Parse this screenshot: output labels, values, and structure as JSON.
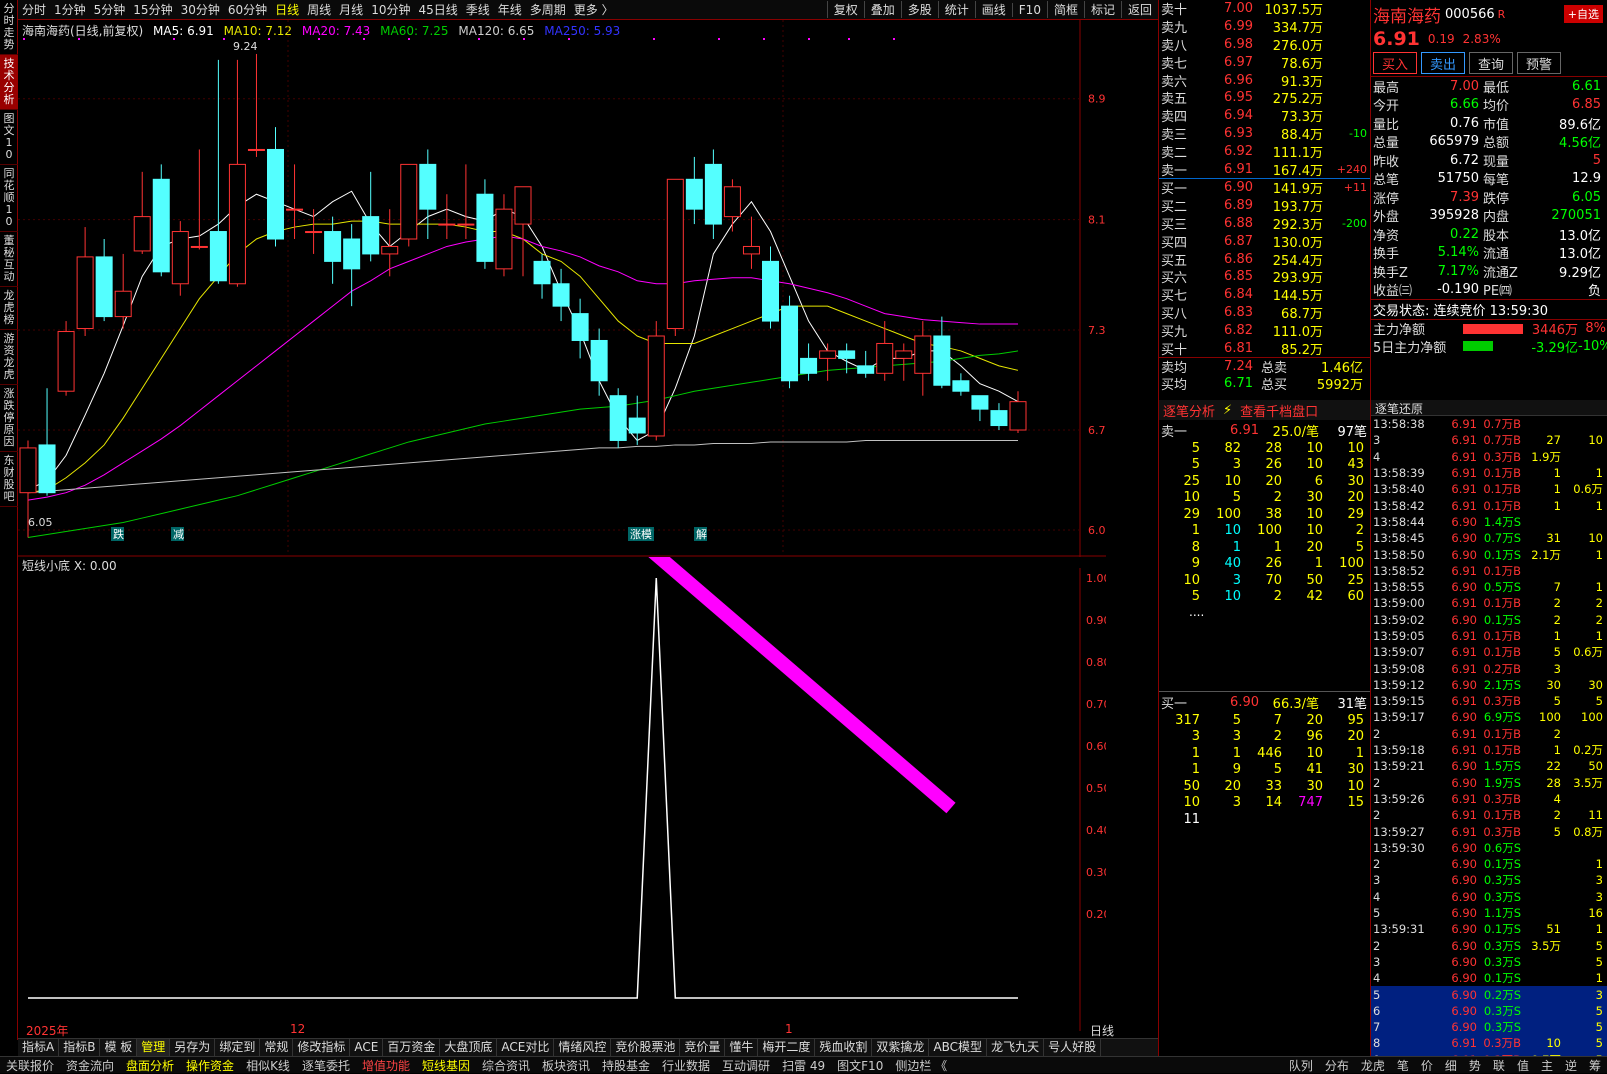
{
  "stock": {
    "name": "海南海药",
    "code": "000566",
    "flag": "R",
    "add_btn": "+自选",
    "price": "6.91",
    "change": "0.19",
    "pct": "2.83%"
  },
  "leftbar": [
    "分时走势",
    "技术分析",
    "图文10",
    "同花顺10",
    "董秘互动",
    "龙虎榜",
    "游资龙虎",
    "涨跌停原因",
    "东财股吧"
  ],
  "periods": [
    "分时",
    "1分钟",
    "5分钟",
    "15分钟",
    "30分钟",
    "60分钟",
    "日线",
    "周线",
    "月线",
    "10分钟",
    "45日线",
    "季线",
    "年线",
    "多周期",
    "更多 〉"
  ],
  "active_period": "日线",
  "right_buttons": [
    "复权",
    "叠加",
    "多股",
    "统计",
    "画线",
    "F10",
    "简框",
    "标记",
    "返回"
  ],
  "chart_info": {
    "title": "海南海药(日线,前复权)",
    "ma5": "MA5: 6.91",
    "ma10": "MA10: 7.12",
    "ma20": "MA20: 7.43",
    "ma60": "MA60: 7.25",
    "ma120": "MA120: 6.65",
    "ma250": "MA250: 5.93"
  },
  "main_axis": [
    "8.94",
    "8.13",
    "7.39",
    "6.72",
    "6.05"
  ],
  "price_marks": {
    "high": "9.24",
    "low": "6.05"
  },
  "sub_title": "短线小底 X: 0.00",
  "sub_axis": [
    "1.00",
    "0.90",
    "0.80",
    "0.70",
    "0.60",
    "0.50",
    "0.40",
    "0.30",
    "0.20"
  ],
  "signals": [
    "跌",
    "减",
    "涨模",
    "解"
  ],
  "date_labels": {
    "d1": "2025年",
    "d2": "12",
    "d3": "1",
    "period": "日线"
  },
  "indicator_tabs": [
    "指标A",
    "指标B",
    "模 板",
    "管理",
    "另存为",
    "绑定到",
    "常规",
    "修改指标",
    "ACE",
    "百万资金",
    "大盘顶底",
    "ACE对比",
    "情绪风控",
    "竞价股票池",
    "竞价量",
    "懂牛",
    "梅开二度",
    "残血收割",
    "双紫擒龙",
    "ABC模型",
    "龙飞九天",
    "号人好股"
  ],
  "bottom_items": [
    "关联报价",
    "资金流向",
    "盘面分析",
    "操作资金",
    "相似K线",
    "逐笔委托",
    "增值功能",
    "短线基因",
    "综合资讯",
    "板块资讯",
    "持股基金",
    "行业数据",
    "互动调研",
    "扫雷 49",
    "图文F10",
    "侧边栏 《"
  ],
  "bottom_tabs": [
    "队列",
    "分布",
    "龙虎",
    "笔",
    "价",
    "细",
    "势",
    "联",
    "值",
    "主",
    "逆",
    "筹"
  ],
  "sell_book": [
    [
      "卖十",
      "7.00",
      "1037.5万",
      ""
    ],
    [
      "卖九",
      "6.99",
      "334.7万",
      ""
    ],
    [
      "卖八",
      "6.98",
      "276.0万",
      ""
    ],
    [
      "卖七",
      "6.97",
      "78.6万",
      ""
    ],
    [
      "卖六",
      "6.96",
      "91.3万",
      ""
    ],
    [
      "卖五",
      "6.95",
      "275.2万",
      ""
    ],
    [
      "卖四",
      "6.94",
      "73.3万",
      ""
    ],
    [
      "卖三",
      "6.93",
      "88.4万",
      "-10"
    ],
    [
      "卖二",
      "6.92",
      "111.1万",
      ""
    ],
    [
      "卖一",
      "6.91",
      "167.4万",
      "+240"
    ]
  ],
  "buy_book": [
    [
      "买一",
      "6.90",
      "141.9万",
      "+11"
    ],
    [
      "买二",
      "6.89",
      "193.7万",
      ""
    ],
    [
      "买三",
      "6.88",
      "292.3万",
      "-200"
    ],
    [
      "买四",
      "6.87",
      "130.0万",
      ""
    ],
    [
      "买五",
      "6.86",
      "254.4万",
      ""
    ],
    [
      "买六",
      "6.85",
      "293.9万",
      ""
    ],
    [
      "买七",
      "6.84",
      "144.5万",
      ""
    ],
    [
      "买八",
      "6.83",
      "68.7万",
      ""
    ],
    [
      "买九",
      "6.82",
      "111.0万",
      ""
    ],
    [
      "买十",
      "6.81",
      "85.2万",
      ""
    ]
  ],
  "avg": {
    "sell_label": "卖均",
    "sell": "7.24",
    "sell_total_label": "总卖",
    "sell_total": "1.46亿",
    "buy_label": "买均",
    "buy": "6.71",
    "buy_total_label": "总买",
    "buy_total": "5992万"
  },
  "zhubi": {
    "title": "逐笔分析",
    "link": "查看千档盘口",
    "sell1": "卖一",
    "sell1_price": "6.91",
    "sell1_avg": "25.0/笔",
    "sell1_count": "97笔",
    "buy1": "买一",
    "buy1_price": "6.90",
    "buy1_avg": "66.3/笔",
    "buy1_count": "31笔",
    "sell_rows": [
      [
        "5",
        "82",
        "28",
        "10",
        "10"
      ],
      [
        "5",
        "3",
        "26",
        "10",
        "43"
      ],
      [
        "25",
        "10",
        "20",
        "6",
        "30"
      ],
      [
        "10",
        "5",
        "2",
        "30",
        "20"
      ],
      [
        "29",
        "100",
        "38",
        "10",
        "29"
      ],
      [
        "1",
        "10",
        "100",
        "10",
        "2"
      ],
      [
        "8",
        "1",
        "1",
        "20",
        "5"
      ],
      [
        "9",
        "40",
        "26",
        "1",
        "100"
      ],
      [
        "10",
        "3",
        "70",
        "50",
        "25"
      ],
      [
        "5",
        "10",
        "2",
        "42",
        "60"
      ]
    ],
    "buy_rows": [
      [
        "317",
        "5",
        "7",
        "20",
        "95"
      ],
      [
        "3",
        "3",
        "2",
        "96",
        "20"
      ],
      [
        "1",
        "1",
        "446",
        "10",
        "1"
      ],
      [
        "1",
        "9",
        "5",
        "41",
        "30"
      ],
      [
        "50",
        "20",
        "33",
        "30",
        "10"
      ],
      [
        "10",
        "3",
        "14",
        "747",
        "15"
      ],
      [
        "11",
        "",
        "",
        "",
        ""
      ]
    ],
    "more": "...."
  },
  "buttons": {
    "buy": "买入",
    "sell": "卖出",
    "query": "查询",
    "alert": "预警"
  },
  "quote": [
    [
      "最高",
      "7.00",
      "最低",
      "6.61"
    ],
    [
      "今开",
      "6.66",
      "均价",
      "6.85"
    ],
    [
      "量比",
      "0.76",
      "市值",
      "89.6亿"
    ],
    [
      "总量",
      "665979",
      "总额",
      "4.56亿"
    ],
    [
      "昨收",
      "6.72",
      "现量",
      "5"
    ],
    [
      "总笔",
      "51750",
      "每笔",
      "12.9"
    ],
    [
      "涨停",
      "7.39",
      "跌停",
      "6.05"
    ],
    [
      "外盘",
      "395928",
      "内盘",
      "270051"
    ],
    [
      "净资",
      "0.22",
      "股本",
      "13.0亿"
    ],
    [
      "换手",
      "5.14%",
      "流通",
      "13.0亿"
    ],
    [
      "换手Z",
      "7.17%",
      "流通Z",
      "9.29亿"
    ],
    [
      "收益㈢",
      "-0.190",
      "PE㈣",
      "负"
    ]
  ],
  "trade_status": "交易状态: 连续竞价 13:59:30",
  "main_flow": {
    "l1": "主力净额",
    "v1": "3446万",
    "p1": "8%",
    "l2": "5日主力净额",
    "v2": "-3.29亿",
    "p2": "-10%"
  },
  "tick_title": "逐笔还原",
  "ticks": [
    [
      "13:58:38",
      "6.91",
      "0.7万B",
      "",
      ""
    ],
    [
      "3",
      "6.91",
      "0.7万B",
      "27",
      "10"
    ],
    [
      "4",
      "6.91",
      "0.3万B",
      "1.9万",
      ""
    ],
    [
      "13:58:39",
      "6.91",
      "0.1万B",
      "1",
      "1"
    ],
    [
      "13:58:40",
      "6.91",
      "0.1万B",
      "1",
      "0.6万"
    ],
    [
      "13:58:42",
      "6.91",
      "0.1万B",
      "1",
      "1"
    ],
    [
      "13:58:44",
      "6.90",
      "1.4万S",
      "",
      ""
    ],
    [
      "13:58:45",
      "6.90",
      "0.7万S",
      "31",
      "10"
    ],
    [
      "13:58:50",
      "6.90",
      "0.1万S",
      "2.1万",
      "1"
    ],
    [
      "13:58:52",
      "6.91",
      "0.1万B",
      "",
      ""
    ],
    [
      "13:58:55",
      "6.90",
      "0.5万S",
      "7",
      "1"
    ],
    [
      "13:59:00",
      "6.91",
      "0.1万B",
      "2",
      "2"
    ],
    [
      "13:59:02",
      "6.90",
      "0.1万S",
      "2",
      "2"
    ],
    [
      "13:59:05",
      "6.91",
      "0.1万B",
      "1",
      "1"
    ],
    [
      "13:59:07",
      "6.91",
      "0.1万B",
      "5",
      "0.6万"
    ],
    [
      "13:59:08",
      "6.91",
      "0.2万B",
      "3",
      ""
    ],
    [
      "13:59:12",
      "6.90",
      "2.1万S",
      "30",
      "30"
    ],
    [
      "13:59:15",
      "6.91",
      "0.3万B",
      "5",
      "5"
    ],
    [
      "13:59:17",
      "6.90",
      "6.9万S",
      "100",
      "100"
    ],
    [
      "2",
      "6.91",
      "0.1万B",
      "2",
      ""
    ],
    [
      "13:59:18",
      "6.91",
      "0.1万B",
      "1",
      "0.2万"
    ],
    [
      "13:59:21",
      "6.90",
      "1.5万S",
      "22",
      "50"
    ],
    [
      "2",
      "6.90",
      "1.9万S",
      "28",
      "3.5万"
    ],
    [
      "13:59:26",
      "6.91",
      "0.3万B",
      "4",
      ""
    ],
    [
      "2",
      "6.91",
      "0.1万B",
      "2",
      "11"
    ],
    [
      "13:59:27",
      "6.91",
      "0.3万B",
      "5",
      "0.8万"
    ],
    [
      "13:59:30",
      "6.90",
      "0.6万S",
      "",
      ""
    ],
    [
      "2",
      "6.90",
      "0.1万S",
      "",
      "1"
    ],
    [
      "3",
      "6.90",
      "0.3万S",
      "",
      "3"
    ],
    [
      "4",
      "6.90",
      "0.3万S",
      "",
      "3"
    ],
    [
      "5",
      "6.90",
      "1.1万S",
      "",
      "16"
    ],
    [
      "13:59:31",
      "6.90",
      "0.1万S",
      "51",
      "1"
    ],
    [
      "2",
      "6.90",
      "0.3万S",
      "3.5万",
      "5"
    ],
    [
      "3",
      "6.90",
      "0.3万S",
      "",
      "5"
    ],
    [
      "4",
      "6.90",
      "0.1万S",
      "",
      "1"
    ],
    [
      "5",
      "6.90",
      "0.2万S",
      "",
      "3"
    ],
    [
      "6",
      "6.90",
      "0.3万S",
      "",
      "5"
    ],
    [
      "7",
      "6.90",
      "0.3万S",
      "",
      "5"
    ],
    [
      "8",
      "6.91",
      "0.3万B",
      "10",
      "5"
    ],
    [
      "9",
      "6.91",
      "0.3万B",
      "0.7万",
      "5"
    ]
  ],
  "colors": {
    "up": "#ff3333",
    "down": "#54ffff",
    "ma5": "#ffffff",
    "ma10": "#e6e600",
    "ma20": "#ff00ff",
    "ma60": "#00cc00",
    "ma120": "#c0c0c0",
    "arrow": "#ff00ff"
  },
  "chart_data": {
    "type": "candlestick",
    "title": "海南海药(日线,前复权)",
    "ylim": [
      6.05,
      9.3
    ],
    "candles": [
      [
        6.3,
        6.6,
        6.0,
        6.65
      ],
      [
        6.62,
        6.3,
        6.28,
        7.0
      ],
      [
        6.98,
        7.38,
        6.95,
        7.45
      ],
      [
        7.4,
        7.88,
        7.35,
        8.08
      ],
      [
        7.88,
        7.48,
        7.45,
        8.0
      ],
      [
        7.48,
        7.65,
        7.4,
        7.9
      ],
      [
        7.92,
        8.15,
        7.9,
        8.45
      ],
      [
        8.4,
        7.78,
        7.75,
        8.5
      ],
      [
        7.7,
        8.05,
        7.62,
        8.12
      ],
      [
        7.95,
        7.95,
        7.93,
        8.6
      ],
      [
        8.05,
        7.72,
        7.7,
        9.2
      ],
      [
        7.7,
        8.5,
        7.68,
        9.2
      ],
      [
        8.6,
        8.6,
        8.55,
        9.24
      ],
      [
        8.6,
        8.0,
        7.95,
        8.75
      ],
      [
        8.2,
        8.2,
        8.0,
        8.5
      ],
      [
        8.05,
        8.05,
        7.9,
        8.2
      ],
      [
        8.05,
        7.85,
        7.7,
        8.15
      ],
      [
        8.0,
        7.8,
        7.55,
        8.1
      ],
      [
        8.15,
        7.9,
        7.85,
        8.45
      ],
      [
        7.9,
        7.95,
        7.75,
        8.2
      ],
      [
        8.0,
        8.5,
        7.95,
        8.5
      ],
      [
        8.5,
        8.2,
        8.0,
        8.6
      ],
      [
        8.1,
        8.1,
        8.0,
        8.3
      ],
      [
        8.1,
        8.1,
        8.0,
        8.5
      ],
      [
        8.3,
        7.85,
        7.8,
        8.4
      ],
      [
        7.8,
        8.2,
        7.75,
        8.3
      ],
      [
        8.1,
        8.35,
        7.75,
        8.35
      ],
      [
        7.85,
        7.7,
        7.6,
        7.9
      ],
      [
        7.7,
        7.55,
        7.45,
        7.8
      ],
      [
        7.5,
        7.32,
        7.2,
        7.6
      ],
      [
        7.32,
        7.05,
        6.95,
        7.4
      ],
      [
        6.95,
        6.65,
        6.6,
        7.0
      ],
      [
        6.8,
        6.7,
        6.62,
        6.95
      ],
      [
        6.68,
        7.35,
        6.65,
        7.45
      ],
      [
        7.4,
        8.4,
        7.35,
        8.4
      ],
      [
        8.4,
        8.2,
        8.1,
        8.55
      ],
      [
        8.5,
        8.1,
        8.0,
        8.6
      ],
      [
        8.15,
        8.35,
        8.05,
        8.4
      ],
      [
        7.9,
        7.95,
        7.8,
        8.15
      ],
      [
        7.85,
        7.45,
        7.4,
        7.95
      ],
      [
        7.55,
        7.05,
        7.0,
        7.62
      ],
      [
        7.2,
        7.1,
        7.05,
        7.3
      ],
      [
        7.2,
        7.25,
        7.05,
        7.3
      ],
      [
        7.25,
        7.2,
        7.1,
        7.3
      ],
      [
        7.15,
        7.1,
        7.07,
        7.25
      ],
      [
        7.1,
        7.3,
        7.05,
        7.45
      ],
      [
        7.2,
        7.25,
        7.05,
        7.3
      ],
      [
        7.1,
        7.35,
        6.95,
        7.45
      ],
      [
        7.35,
        7.02,
        7.0,
        7.48
      ],
      [
        7.05,
        6.98,
        6.95,
        7.1
      ],
      [
        6.95,
        6.86,
        6.78,
        6.95
      ],
      [
        6.85,
        6.75,
        6.72,
        6.9
      ],
      [
        6.72,
        6.91,
        6.7,
        6.98
      ]
    ],
    "ma5": [
      6.32,
      6.38,
      6.55,
      6.82,
      7.1,
      7.42,
      7.75,
      7.95,
      8.0,
      8.02,
      8.1,
      8.22,
      8.3,
      8.25,
      8.2,
      8.15,
      8.25,
      8.32,
      8.1,
      7.95,
      8.05,
      8.15,
      8.2,
      8.15,
      8.12,
      8.2,
      8.15,
      7.95,
      7.65,
      7.38,
      7.05,
      6.8,
      6.65,
      6.72,
      7.0,
      7.35,
      7.9,
      8.1,
      8.25,
      8.05,
      7.75,
      7.45,
      7.25,
      7.18,
      7.12,
      7.2,
      7.2,
      7.25,
      7.25,
      7.15,
      7.03,
      6.98,
      6.91
    ],
    "ma10": [
      6.3,
      6.32,
      6.4,
      6.5,
      6.62,
      6.8,
      7.0,
      7.2,
      7.4,
      7.6,
      7.75,
      7.9,
      8.0,
      8.05,
      8.08,
      8.1,
      8.1,
      8.12,
      8.12,
      8.1,
      8.1,
      8.1,
      8.1,
      8.08,
      8.05,
      8.05,
      8.0,
      7.9,
      7.85,
      7.75,
      7.6,
      7.45,
      7.35,
      7.3,
      7.3,
      7.3,
      7.35,
      7.4,
      7.45,
      7.5,
      7.55,
      7.55,
      7.55,
      7.5,
      7.45,
      7.4,
      7.35,
      7.3,
      7.28,
      7.25,
      7.2,
      7.15,
      7.12
    ],
    "ma20": [
      6.25,
      6.27,
      6.3,
      6.35,
      6.42,
      6.5,
      6.58,
      6.66,
      6.75,
      6.85,
      6.95,
      7.05,
      7.15,
      7.25,
      7.35,
      7.45,
      7.55,
      7.65,
      7.72,
      7.8,
      7.85,
      7.9,
      7.95,
      7.98,
      8.0,
      8.02,
      8.0,
      7.95,
      7.92,
      7.88,
      7.82,
      7.78,
      7.72,
      7.7,
      7.7,
      7.72,
      7.73,
      7.74,
      7.74,
      7.72,
      7.7,
      7.67,
      7.64,
      7.6,
      7.55,
      7.5,
      7.48,
      7.46,
      7.45,
      7.44,
      7.43,
      7.43,
      7.43
    ],
    "ma60": [
      6.0,
      6.02,
      6.04,
      6.06,
      6.08,
      6.1,
      6.13,
      6.16,
      6.19,
      6.22,
      6.25,
      6.28,
      6.32,
      6.36,
      6.4,
      6.44,
      6.48,
      6.52,
      6.56,
      6.6,
      6.64,
      6.67,
      6.7,
      6.73,
      6.76,
      6.78,
      6.8,
      6.82,
      6.84,
      6.86,
      6.87,
      6.88,
      6.9,
      6.92,
      6.95,
      6.98,
      7.0,
      7.02,
      7.04,
      7.06,
      7.08,
      7.1,
      7.12,
      7.13,
      7.14,
      7.15,
      7.16,
      7.17,
      7.18,
      7.2,
      7.22,
      7.23,
      7.25
    ],
    "ma120": [
      6.3,
      6.31,
      6.32,
      6.33,
      6.34,
      6.35,
      6.36,
      6.37,
      6.38,
      6.39,
      6.4,
      6.41,
      6.42,
      6.43,
      6.44,
      6.45,
      6.46,
      6.47,
      6.48,
      6.49,
      6.5,
      6.51,
      6.52,
      6.53,
      6.54,
      6.55,
      6.56,
      6.57,
      6.58,
      6.59,
      6.6,
      6.6,
      6.61,
      6.61,
      6.62,
      6.62,
      6.63,
      6.63,
      6.63,
      6.64,
      6.64,
      6.64,
      6.64,
      6.64,
      6.65,
      6.65,
      6.65,
      6.65,
      6.65,
      6.65,
      6.65,
      6.65,
      6.65
    ],
    "signal": [
      0,
      0,
      0,
      0,
      0,
      0,
      0,
      0,
      0,
      0,
      0,
      0,
      0,
      0,
      0,
      0,
      0,
      0,
      0,
      0,
      0,
      0,
      0,
      0,
      0,
      0,
      0,
      0,
      0,
      0,
      0,
      0,
      0,
      1,
      0,
      0,
      0,
      0,
      0,
      0,
      0,
      0,
      0,
      0,
      0,
      0,
      0,
      0,
      0,
      0,
      0,
      0,
      0
    ],
    "sub_ylim": [
      0,
      1.0
    ]
  }
}
